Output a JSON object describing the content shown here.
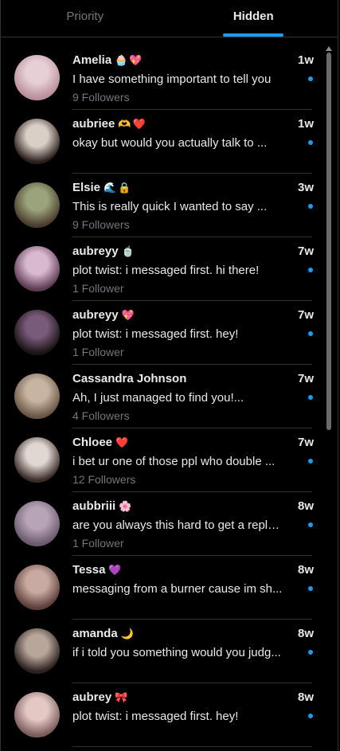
{
  "tabs": [
    {
      "label": "Priority",
      "active": false
    },
    {
      "label": "Hidden",
      "active": true
    }
  ],
  "conversations": [
    {
      "name": "Amelia",
      "emojis": [
        "🧁",
        "💖"
      ],
      "time": "1w",
      "message": "I have something important to tell you",
      "followers": "9 Followers",
      "avatar_colors": [
        "#e6d0d6",
        "#b98f9b"
      ]
    },
    {
      "name": "aubriee",
      "emojis": [
        "🫶",
        "❤️"
      ],
      "time": "1w",
      "message": "okay but would you actually talk to ...",
      "followers": "",
      "avatar_colors": [
        "#d9cfc6",
        "#2b1f1c"
      ]
    },
    {
      "name": "Elsie",
      "emojis": [
        "🌊",
        "🔒"
      ],
      "time": "3w",
      "message": "This is really quick I wanted to say ...",
      "followers": "9 Followers",
      "avatar_colors": [
        "#9aa37a",
        "#4b3d2e"
      ]
    },
    {
      "name": "aubreyy",
      "emojis": [
        "🍵"
      ],
      "time": "7w",
      "message": "plot twist: i messaged first. hi there!",
      "followers": "1 Follower",
      "avatar_colors": [
        "#d8b9cf",
        "#5b3c52"
      ]
    },
    {
      "name": "aubreyy",
      "emojis": [
        "💖"
      ],
      "time": "7w",
      "message": "plot twist: i messaged first. hey!",
      "followers": "1 Follower",
      "avatar_colors": [
        "#7a5a7b",
        "#1a1414"
      ]
    },
    {
      "name": "Cassandra Johnson",
      "emojis": [],
      "time": "7w",
      "message": "Ah, I just managed to find you!...",
      "followers": "4 Followers",
      "avatar_colors": [
        "#c7b4a1",
        "#6b5646"
      ]
    },
    {
      "name": "Chloee",
      "emojis": [
        "❤️"
      ],
      "time": "7w",
      "message": "i bet ur one of those ppl who double ...",
      "followers": "12 Followers",
      "avatar_colors": [
        "#e0d6d2",
        "#3a2b27"
      ]
    },
    {
      "name": "aubbriii",
      "emojis": [
        "🌸"
      ],
      "time": "8w",
      "message": "are you always this hard to get a reply ...",
      "followers": "1 Follower",
      "avatar_colors": [
        "#b7a4b6",
        "#6a5a6e"
      ]
    },
    {
      "name": "Tessa",
      "emojis": [
        "💜"
      ],
      "time": "8w",
      "message": "messaging from a burner cause im sh...",
      "followers": "",
      "avatar_colors": [
        "#c9aaa2",
        "#5d3f3a"
      ]
    },
    {
      "name": "amanda",
      "emojis": [
        "🌙"
      ],
      "time": "8w",
      "message": "if i told you something would you judg...",
      "followers": "",
      "avatar_colors": [
        "#b9a69a",
        "#2a2120"
      ]
    },
    {
      "name": "aubrey",
      "emojis": [
        "🎀"
      ],
      "time": "8w",
      "message": "plot twist: i messaged first. hey!",
      "followers": "",
      "avatar_colors": [
        "#e3c8c4",
        "#7b5c5a"
      ]
    }
  ],
  "colors": {
    "accent": "#1d9bf0",
    "background": "#000000",
    "muted_text": "#71767b",
    "divider": "#2f3336"
  },
  "icons": {
    "unread": "unread-dot-icon"
  }
}
